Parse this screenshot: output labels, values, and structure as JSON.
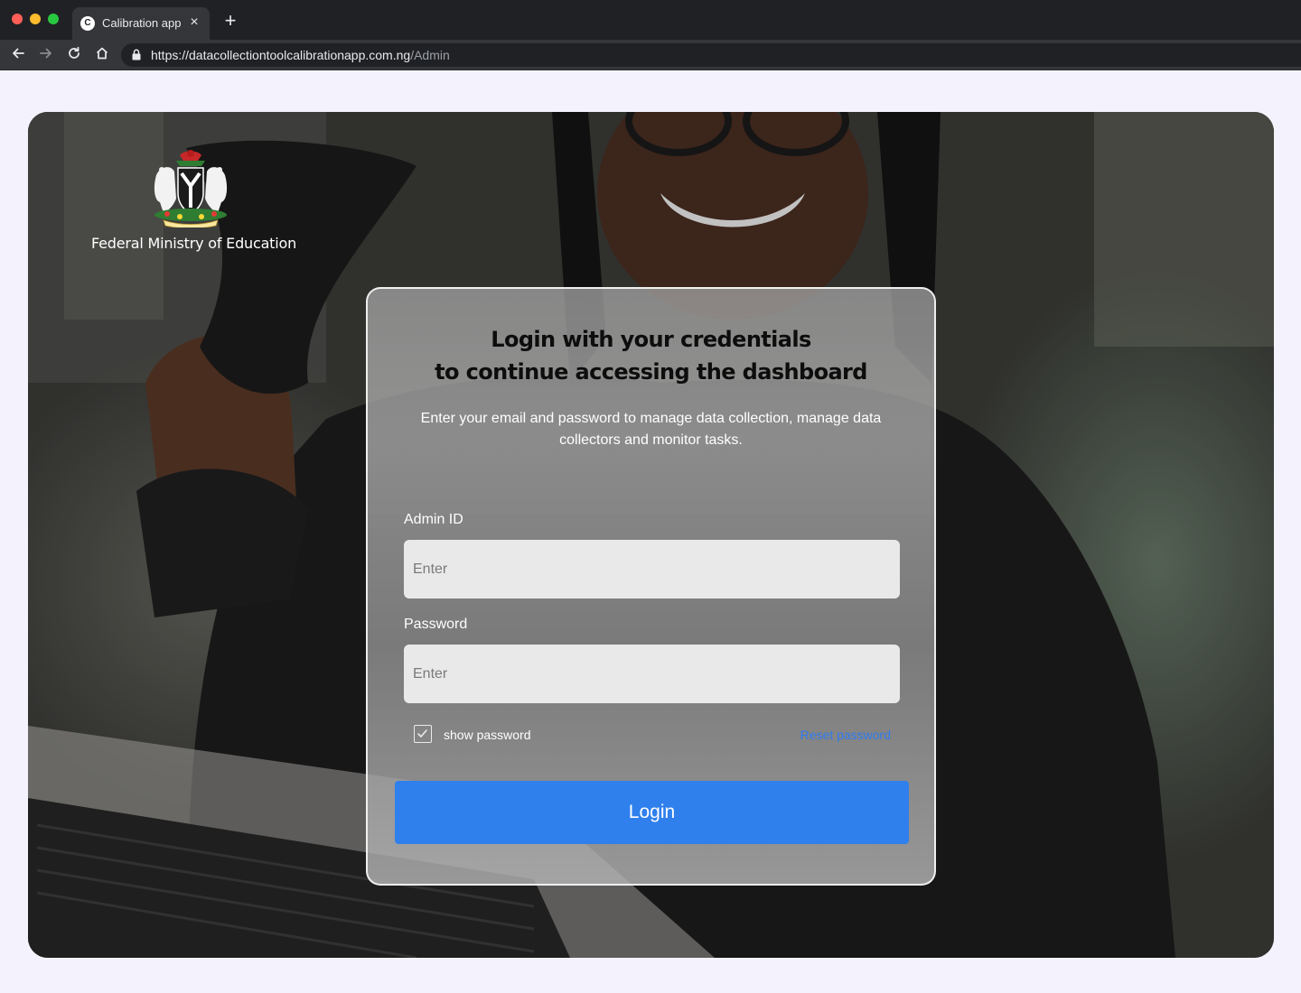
{
  "browser": {
    "tab_title": "Calibration app",
    "tab_favicon_letter": "C",
    "url_host": "https://datacollectiontoolcalibrationapp.com.ng",
    "url_path": "/Admin"
  },
  "brand": {
    "crest_icon": "nigeria-coat-of-arms",
    "name": "Federal Ministry of Education"
  },
  "login": {
    "title_line1": "Login with your credentials",
    "title_line2": "to continue accessing the dashboard",
    "subtitle": "Enter your email and password to manage data collection, manage data collectors and monitor tasks.",
    "admin_label": "Admin ID",
    "admin_placeholder": "Enter",
    "password_label": "Password",
    "password_placeholder": "Enter",
    "show_password_label": "show password",
    "show_password_checked": true,
    "reset_label": "Reset password",
    "button_label": "Login"
  },
  "colors": {
    "accent": "#2f80ed",
    "link": "#2f7bf0",
    "page_bg": "#f4f3fd"
  }
}
